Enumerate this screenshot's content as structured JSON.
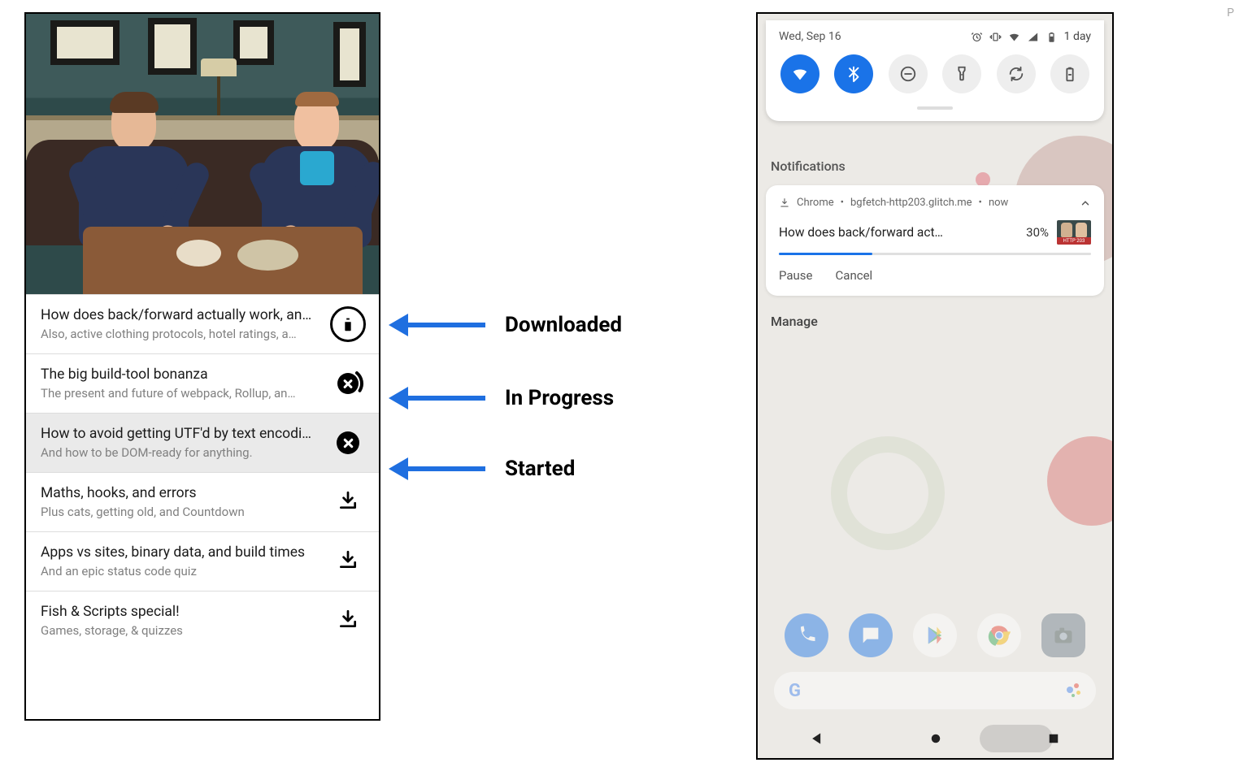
{
  "left_app": {
    "episodes": [
      {
        "title": "How does back/forward actually work, an…",
        "subtitle": "Also, active clothing protocols, hotel ratings, a…",
        "state": "downloaded",
        "active": false
      },
      {
        "title": "The big build-tool bonanza",
        "subtitle": "The present and future of webpack, Rollup, an…",
        "state": "in_progress",
        "active": false
      },
      {
        "title": "How to avoid getting UTF'd by text encodi…",
        "subtitle": "And how to be DOM-ready for anything.",
        "state": "started",
        "active": true
      },
      {
        "title": "Maths, hooks, and errors",
        "subtitle": "Plus cats, getting old, and Countdown",
        "state": "idle",
        "active": false
      },
      {
        "title": "Apps vs sites, binary data, and build times",
        "subtitle": "And an epic status code quiz",
        "state": "idle",
        "active": false
      },
      {
        "title": "Fish & Scripts special!",
        "subtitle": "Games, storage, & quizzes",
        "state": "idle",
        "active": false
      }
    ]
  },
  "annotations": {
    "downloaded": "Downloaded",
    "in_progress": "In Progress",
    "started": "Started"
  },
  "android": {
    "status": {
      "date": "Wed, Sep 16",
      "battery_text": "1 day"
    },
    "tiles": [
      {
        "name": "wifi",
        "on": true
      },
      {
        "name": "bluetooth",
        "on": true
      },
      {
        "name": "dnd",
        "on": false
      },
      {
        "name": "flashlight",
        "on": false
      },
      {
        "name": "rotate",
        "on": false
      },
      {
        "name": "battery-saver",
        "on": false
      }
    ],
    "notifications_header": "Notifications",
    "notification": {
      "app": "Chrome",
      "source": "bgfetch-http203.glitch.me",
      "time": "now",
      "title": "How does back/forward act…",
      "percent_text": "30%",
      "percent_value": 30,
      "actions": {
        "pause": "Pause",
        "cancel": "Cancel"
      }
    },
    "manage": "Manage",
    "google_logo": "Google"
  }
}
